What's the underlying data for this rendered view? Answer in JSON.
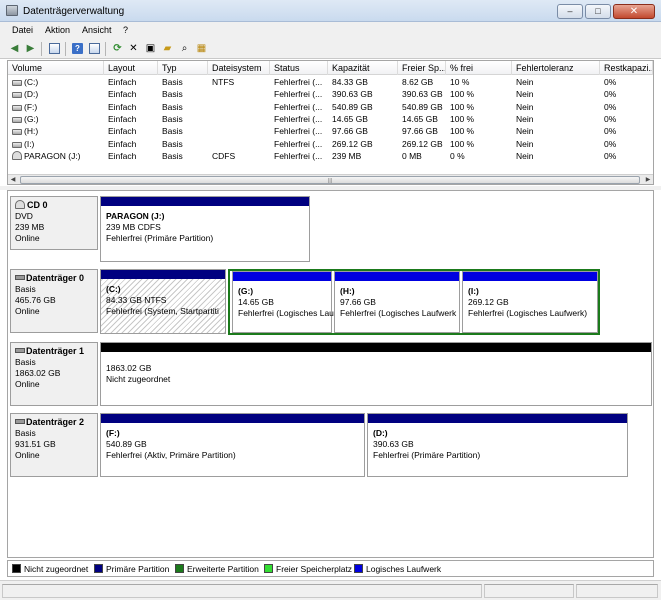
{
  "window": {
    "title": "Datenträgerverwaltung",
    "minimize": "–",
    "maximize": "□",
    "close": "✕"
  },
  "menu": [
    "Datei",
    "Aktion",
    "Ansicht",
    "?"
  ],
  "toolbar": {
    "icons": [
      "back-icon",
      "forward-icon",
      "console-tree-icon",
      "help-icon",
      "properties-icon",
      "refresh-icon",
      "delete-icon",
      "new-volume-icon",
      "open-icon",
      "search-icon",
      "settings-icon"
    ]
  },
  "volume_list": {
    "columns": [
      "Volume",
      "Layout",
      "Typ",
      "Dateisystem",
      "Status",
      "Kapazität",
      "Freier Sp...",
      "% frei",
      "Fehlertoleranz",
      "Restkapazi..."
    ],
    "rows": [
      [
        "(C:)",
        "Einfach",
        "Basis",
        "NTFS",
        "Fehlerfrei (...",
        "84.33 GB",
        "8.62 GB",
        "10 %",
        "Nein",
        "0%"
      ],
      [
        "(D:)",
        "Einfach",
        "Basis",
        "",
        "Fehlerfrei (...",
        "390.63 GB",
        "390.63 GB",
        "100 %",
        "Nein",
        "0%"
      ],
      [
        "(F:)",
        "Einfach",
        "Basis",
        "",
        "Fehlerfrei (...",
        "540.89 GB",
        "540.89 GB",
        "100 %",
        "Nein",
        "0%"
      ],
      [
        "(G:)",
        "Einfach",
        "Basis",
        "",
        "Fehlerfrei (...",
        "14.65 GB",
        "14.65 GB",
        "100 %",
        "Nein",
        "0%"
      ],
      [
        "(H:)",
        "Einfach",
        "Basis",
        "",
        "Fehlerfrei (...",
        "97.66 GB",
        "97.66 GB",
        "100 %",
        "Nein",
        "0%"
      ],
      [
        "(I:)",
        "Einfach",
        "Basis",
        "",
        "Fehlerfrei (...",
        "269.12 GB",
        "269.12 GB",
        "100 %",
        "Nein",
        "0%"
      ],
      [
        "PARAGON (J:)",
        "Einfach",
        "Basis",
        "CDFS",
        "Fehlerfrei (...",
        "239 MB",
        "0 MB",
        "0 %",
        "Nein",
        "0%"
      ]
    ]
  },
  "disks": {
    "cd0": {
      "name": "CD 0",
      "type": "DVD",
      "size": "239 MB",
      "state": "Online",
      "partitions": [
        {
          "name": "PARAGON  (J:)",
          "size": "239 MB CDFS",
          "status": "Fehlerfrei (Primäre Partition)"
        }
      ]
    },
    "disk0": {
      "name": "Datenträger 0",
      "type": "Basis",
      "size": "465.76 GB",
      "state": "Online",
      "partitions": [
        {
          "name": "(C:)",
          "size": "84.33 GB NTFS",
          "status": "Fehlerfrei (System, Startpartiti"
        },
        {
          "name": "(G:)",
          "size": "14.65 GB",
          "status": "Fehlerfrei (Logisches Lau"
        },
        {
          "name": "(H:)",
          "size": "97.66 GB",
          "status": "Fehlerfrei (Logisches Laufwerk"
        },
        {
          "name": "(I:)",
          "size": "269.12 GB",
          "status": "Fehlerfrei (Logisches Laufwerk)"
        }
      ]
    },
    "disk1": {
      "name": "Datenträger 1",
      "type": "Basis",
      "size": "1863.02 GB",
      "state": "Online",
      "partitions": [
        {
          "name": "",
          "size": "1863.02 GB",
          "status": "Nicht zugeordnet"
        }
      ]
    },
    "disk2": {
      "name": "Datenträger 2",
      "type": "Basis",
      "size": "931.51 GB",
      "state": "Online",
      "partitions": [
        {
          "name": "(F:)",
          "size": "540.89 GB",
          "status": "Fehlerfrei (Aktiv, Primäre Partition)"
        },
        {
          "name": "(D:)",
          "size": "390.63 GB",
          "status": "Fehlerfrei (Primäre Partition)"
        }
      ]
    }
  },
  "legend": [
    {
      "label": "Nicht zugeordnet",
      "color": "#000000"
    },
    {
      "label": "Primäre Partition",
      "color": "#000080"
    },
    {
      "label": "Erweiterte Partition",
      "color": "#1b7a1b"
    },
    {
      "label": "Freier Speicherplatz",
      "color": "#33dd33"
    },
    {
      "label": "Logisches Laufwerk",
      "color": "#0000e0"
    }
  ]
}
